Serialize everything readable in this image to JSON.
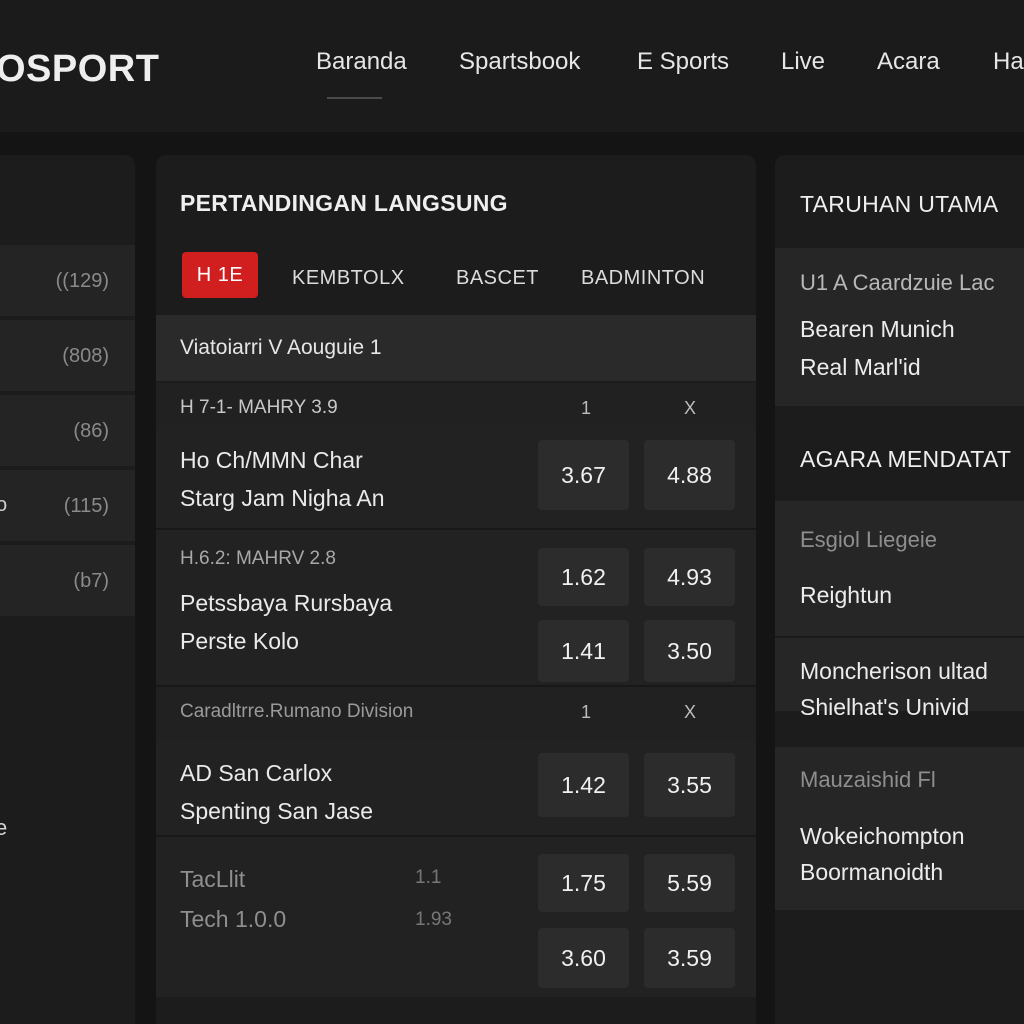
{
  "header": {
    "logo": "OSPORT",
    "nav": [
      "Baranda",
      "Spartsbook",
      "E Sports",
      "Live",
      "Acara",
      "Ha"
    ]
  },
  "left": {
    "counts": [
      "((129)",
      "(808)",
      "(86)",
      "(115)",
      "(b7)"
    ],
    "marks": [
      "",
      "",
      "",
      "o",
      ""
    ],
    "extra": "e"
  },
  "center": {
    "title": "PERTANDINGAN LANGSUNG",
    "tabs": [
      "H 1E",
      "KEMBTOLX",
      "BASCET",
      "BADMINTON"
    ],
    "league1": "Viatoiarri V Aouguie 1",
    "section1": {
      "label": "H 7-1- MAHRY 3.9",
      "col1": "1",
      "colx": "X"
    },
    "match1": {
      "home": "Ho Ch/MMN Char",
      "away": "Starg Jam Nigha An",
      "odd1": "3.67",
      "oddx": "4.88"
    },
    "match2": {
      "meta": "H.6.2: MAHRV 2.8",
      "home": "Petssbaya Rursbaya",
      "away": "Perste Kolo",
      "odd1a": "1.62",
      "oddxa": "4.93",
      "odd1b": "1.41",
      "oddxb": "3.50"
    },
    "section2": {
      "label": "Caradltrre.Rumano Division",
      "col1": "1",
      "colx": "X"
    },
    "match3": {
      "home": "AD San Carlox",
      "away": "Spenting San Jase",
      "odd1": "1.42",
      "oddx": "3.55"
    },
    "match4": {
      "home": "TacLlit",
      "away": "Tech 1.0.0",
      "meta1": "1.1",
      "meta2": "1.93",
      "odd1a": "1.75",
      "oddxa": "5.59",
      "odd1b": "3.60",
      "oddxb": "3.59"
    }
  },
  "right": {
    "title": "TARUHAN UTAMA",
    "block1": {
      "league": "U1 A Caardzuie Lac",
      "home": "Bearen Munich",
      "away": "Real Marl'id"
    },
    "title2": "AGARA MENDATAT",
    "block2": {
      "league": "Esgiol Liegeie",
      "team": "Reightun",
      "home": "Moncherison ultad",
      "away": "Shielhat's Univid"
    },
    "block3": {
      "league": "Mauzaishid Fl",
      "home": "Wokeichompton",
      "away": "Boormanoidth"
    }
  }
}
